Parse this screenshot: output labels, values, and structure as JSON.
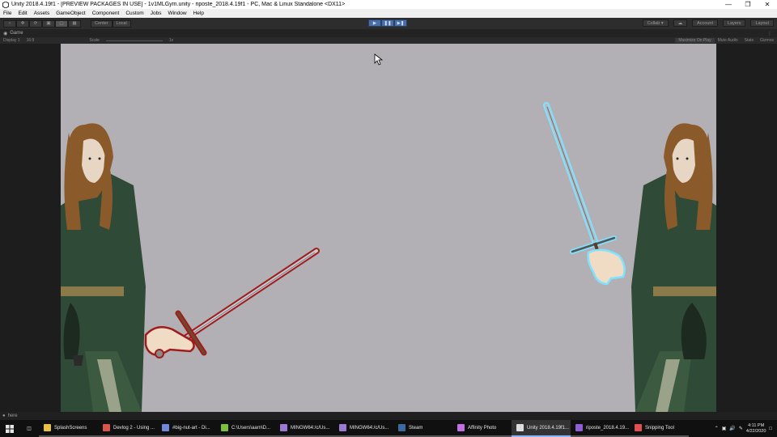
{
  "window": {
    "title": "Unity 2018.4.19f1 - [PREVIEW PACKAGES IN USE] - 1v1MLGym.unity - riposte_2018.4.19f1 - PC, Mac & Linux Standalone <DX11>",
    "minimize": "—",
    "maximize": "❐",
    "close": "✕"
  },
  "menu": [
    "File",
    "Edit",
    "Assets",
    "GameObject",
    "Component",
    "Custom",
    "Jobs",
    "Window",
    "Help"
  ],
  "toolbar": {
    "pivot": "Center",
    "space": "Local",
    "collab": "Collab ▾",
    "account": "Account",
    "layers": "Layers",
    "layout": "Layout"
  },
  "game_tab": {
    "label": "Game",
    "menu": "⋮"
  },
  "game_bar": {
    "display": "Display 1",
    "aspect": "16:9",
    "scale_label": "Scale",
    "scale_value": "1x",
    "maximize_on_play": "Maximize On Play",
    "mute_audio": "Mute Audio",
    "stats": "Stats",
    "gizmos": "Gizmos"
  },
  "status": {
    "text": "here"
  },
  "taskbar": {
    "apps": [
      {
        "label": "SplashScreens",
        "color": "#e8c246"
      },
      {
        "label": "Devlog 2 - Using ...",
        "color": "#d9534f"
      },
      {
        "label": "#big-nut-art - Di...",
        "color": "#7289da"
      },
      {
        "label": "C:\\Users\\aarn\\D...",
        "color": "#7fbf3f"
      },
      {
        "label": "MINGW64:/c/Us...",
        "color": "#9a7bd1"
      },
      {
        "label": "MINGW64:/c/Us...",
        "color": "#9a7bd1"
      },
      {
        "label": "Steam",
        "color": "#3b6aa0"
      },
      {
        "label": "Affinity Photo",
        "color": "#c070e0"
      },
      {
        "label": "Unity 2018.4.19f1...",
        "color": "#dddddd"
      },
      {
        "label": "riposte_2018.4.19...",
        "color": "#8d5fd3"
      },
      {
        "label": "Snipping Tool",
        "color": "#e05050"
      }
    ],
    "time": "4:11 PM",
    "date": "4/22/2020"
  },
  "colors": {
    "viewport_bg": "#b2b0b4",
    "red_outline": "#a01c1c",
    "blue_outline": "#7fe3ff",
    "tunic": "#2f4a36",
    "hair": "#8a5a2b"
  }
}
